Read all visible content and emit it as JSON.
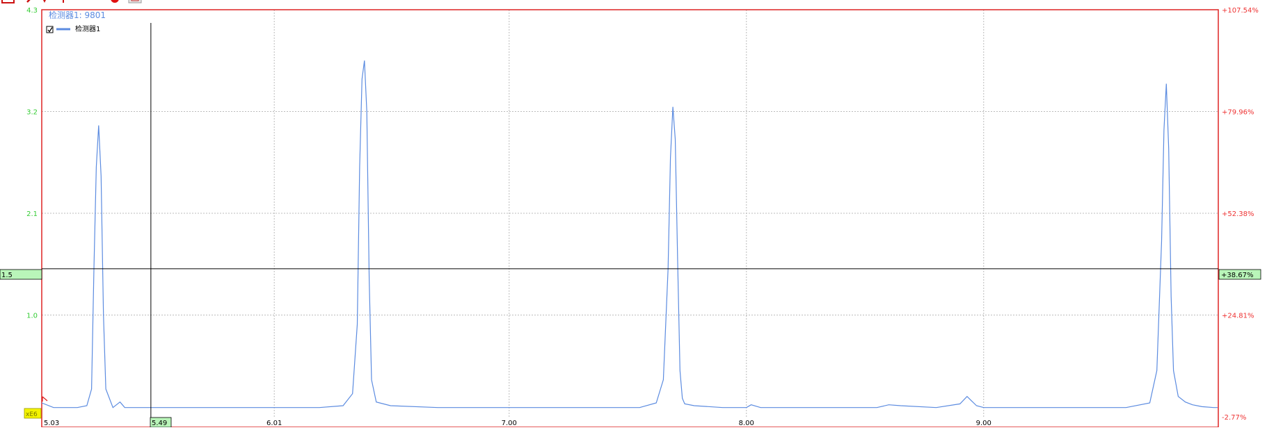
{
  "toolbar": {
    "icons": [
      "square-outline-icon",
      "undo-arrow-icon",
      "marker-icon",
      "dash-icon",
      "record-dot-icon",
      "window-icon"
    ]
  },
  "chart_data": {
    "type": "line",
    "title": "检测器1: 9801",
    "legend": {
      "label": "检测器1",
      "checked": true,
      "placement": "top-left"
    },
    "grid": true,
    "xlim": [
      5.03,
      10.0
    ],
    "ylim": [
      -0.1,
      4.3
    ],
    "x_ticks": [
      {
        "value": 5.03,
        "label": "5.03"
      },
      {
        "value": 6.01,
        "label": "6.01"
      },
      {
        "value": 7.0,
        "label": "7.00"
      },
      {
        "value": 8.0,
        "label": "8.00"
      },
      {
        "value": 9.0,
        "label": "9.00"
      }
    ],
    "y_ticks": [
      {
        "value": 4.3,
        "label": "4.3"
      },
      {
        "value": 3.2,
        "label": "3.2"
      },
      {
        "value": 2.1,
        "label": "2.1"
      },
      {
        "value": 1.0,
        "label": "1.0"
      }
    ],
    "y_multiplier_label": "xE6",
    "right_ticks": [
      {
        "value": 4.3,
        "label": "+107.54%"
      },
      {
        "value": 3.2,
        "label": "+79.96%"
      },
      {
        "value": 2.1,
        "label": "+52.38%"
      },
      {
        "value": 1.0,
        "label": "+24.81%"
      },
      {
        "value": -0.1,
        "label": "-2.77%"
      }
    ],
    "cursor": {
      "x": 5.49,
      "x_label": "5.49",
      "y": 1.5,
      "y_label": "1.5",
      "right_label": "+38.67%"
    },
    "series": [
      {
        "color": "#5b8be0",
        "x": [
          5.03,
          5.08,
          5.12,
          5.18,
          5.22,
          5.24,
          5.25,
          5.26,
          5.27,
          5.28,
          5.29,
          5.3,
          5.33,
          5.36,
          5.37,
          5.38,
          5.42,
          5.6,
          5.8,
          6.0,
          6.2,
          6.3,
          6.34,
          6.36,
          6.37,
          6.38,
          6.39,
          6.4,
          6.41,
          6.42,
          6.44,
          6.5,
          6.7,
          7.0,
          7.3,
          7.55,
          7.62,
          7.65,
          7.67,
          7.68,
          7.69,
          7.7,
          7.71,
          7.72,
          7.73,
          7.74,
          7.78,
          7.9,
          8.0,
          8.02,
          8.06,
          8.3,
          8.55,
          8.6,
          8.65,
          8.8,
          8.9,
          8.93,
          8.95,
          8.97,
          9.0,
          9.3,
          9.6,
          9.7,
          9.73,
          9.75,
          9.76,
          9.77,
          9.78,
          9.79,
          9.8,
          9.82,
          9.85,
          9.88,
          9.92,
          9.97,
          10.0
        ],
        "y": [
          0.05,
          0.0,
          0.0,
          0.0,
          0.02,
          0.2,
          1.5,
          2.6,
          3.05,
          2.5,
          1.0,
          0.2,
          0.0,
          0.06,
          0.03,
          0.0,
          0.0,
          0.0,
          0.0,
          0.0,
          0.0,
          0.02,
          0.15,
          0.9,
          2.6,
          3.55,
          3.75,
          3.2,
          1.4,
          0.3,
          0.06,
          0.02,
          0.0,
          0.0,
          0.0,
          0.0,
          0.05,
          0.3,
          1.5,
          2.7,
          3.25,
          2.9,
          1.6,
          0.4,
          0.1,
          0.04,
          0.02,
          0.0,
          0.0,
          0.03,
          0.0,
          0.0,
          0.0,
          0.03,
          0.02,
          0.0,
          0.04,
          0.12,
          0.07,
          0.02,
          0.0,
          0.0,
          0.0,
          0.05,
          0.4,
          1.8,
          3.0,
          3.5,
          2.8,
          1.2,
          0.4,
          0.12,
          0.06,
          0.03,
          0.01,
          0.0,
          0.0
        ]
      }
    ]
  }
}
